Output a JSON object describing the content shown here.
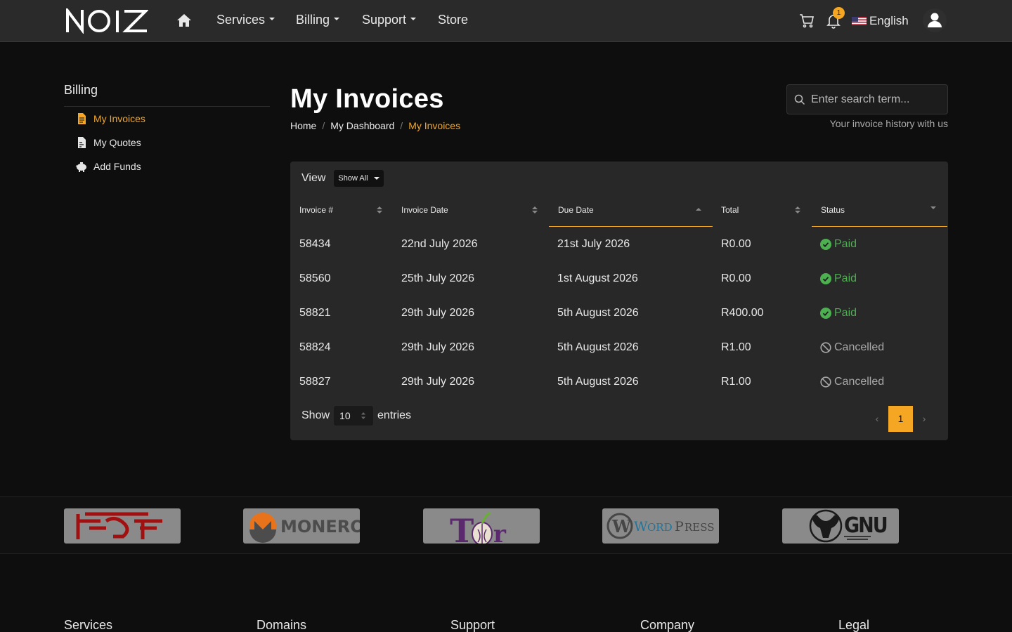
{
  "nav": {
    "brand": "NOIZ",
    "items": [
      {
        "label": "Services",
        "dropdown": true
      },
      {
        "label": "Billing",
        "dropdown": true
      },
      {
        "label": "Support",
        "dropdown": true
      },
      {
        "label": "Store",
        "dropdown": false
      }
    ],
    "notification_count": "1",
    "language": "English"
  },
  "sidebar": {
    "title": "Billing",
    "items": [
      {
        "label": "My Invoices",
        "icon": "file-invoice-icon",
        "active": true
      },
      {
        "label": "My Quotes",
        "icon": "file-quote-icon",
        "active": false
      },
      {
        "label": "Add Funds",
        "icon": "piggy-bank-icon",
        "active": false
      }
    ]
  },
  "header": {
    "title": "My Invoices",
    "breadcrumb": [
      "Home",
      "My Dashboard",
      "My Invoices"
    ],
    "search_placeholder": "Enter search term...",
    "subtitle": "Your invoice history with us"
  },
  "table": {
    "view_label": "View",
    "view_option": "Show All",
    "columns": [
      "Invoice #",
      "Invoice Date",
      "Due Date",
      "Total",
      "Status"
    ],
    "rows": [
      {
        "invoice": "58434",
        "date": "22nd July 2026",
        "due": "21st July 2026",
        "total": "R0.00",
        "status": "Paid"
      },
      {
        "invoice": "58560",
        "date": "25th July 2026",
        "due": "1st August 2026",
        "total": "R0.00",
        "status": "Paid"
      },
      {
        "invoice": "58821",
        "date": "29th July 2026",
        "due": "5th August 2026",
        "total": "R400.00",
        "status": "Paid"
      },
      {
        "invoice": "58824",
        "date": "29th July 2026",
        "due": "5th August 2026",
        "total": "R1.00",
        "status": "Cancelled"
      },
      {
        "invoice": "58827",
        "date": "29th July 2026",
        "due": "5th August 2026",
        "total": "R1.00",
        "status": "Cancelled"
      }
    ],
    "show_label": "Show",
    "page_length": "10",
    "entries_label": "entries",
    "pagination": {
      "prev": "‹",
      "current": "1",
      "next": "›"
    }
  },
  "partners": [
    {
      "name": "FSF",
      "icon": "fsf-logo"
    },
    {
      "name": "MONERO",
      "icon": "monero-logo"
    },
    {
      "name": "Tor",
      "icon": "tor-logo"
    },
    {
      "name": "WordPress",
      "icon": "wordpress-logo"
    },
    {
      "name": "GNU",
      "icon": "gnu-logo"
    }
  ],
  "footer": {
    "columns": [
      "Services",
      "Domains",
      "Support",
      "Company",
      "Legal"
    ]
  },
  "colors": {
    "accent": "#f5a623",
    "paid": "#4caf50",
    "cancelled": "#a8a8a8",
    "navbar": "#2a2a2a",
    "card": "#282828"
  }
}
